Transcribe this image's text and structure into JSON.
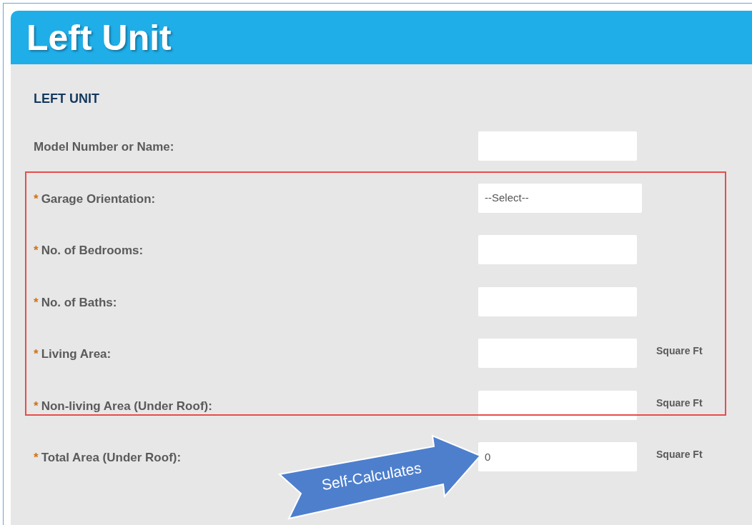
{
  "header": {
    "title": "Left Unit"
  },
  "section": {
    "heading": "LEFT UNIT"
  },
  "fields": [
    {
      "label": "Model Number or Name:",
      "kind": "text"
    },
    {
      "mark": "*",
      "label": "Garage Orientation:",
      "kind": "select",
      "value": "--Select--"
    },
    {
      "mark": "*",
      "label": "No. of Bedrooms:",
      "kind": "text"
    },
    {
      "mark": "*",
      "label": "No. of Baths:",
      "kind": "text"
    },
    {
      "mark": "*",
      "label": "Living Area:",
      "kind": "text",
      "unit": "Square Ft"
    },
    {
      "mark": "*",
      "label": "Non-living Area (Under Roof):",
      "kind": "text",
      "unit": "Square Ft"
    },
    {
      "mark": "*",
      "label": "Total Area (Under Roof):",
      "kind": "text",
      "value": "0",
      "unit": "Square Ft"
    }
  ],
  "annotations": [
    {
      "kind": "highlight"
    },
    {
      "kind": "callout",
      "text": "Self-Calculates"
    }
  ]
}
